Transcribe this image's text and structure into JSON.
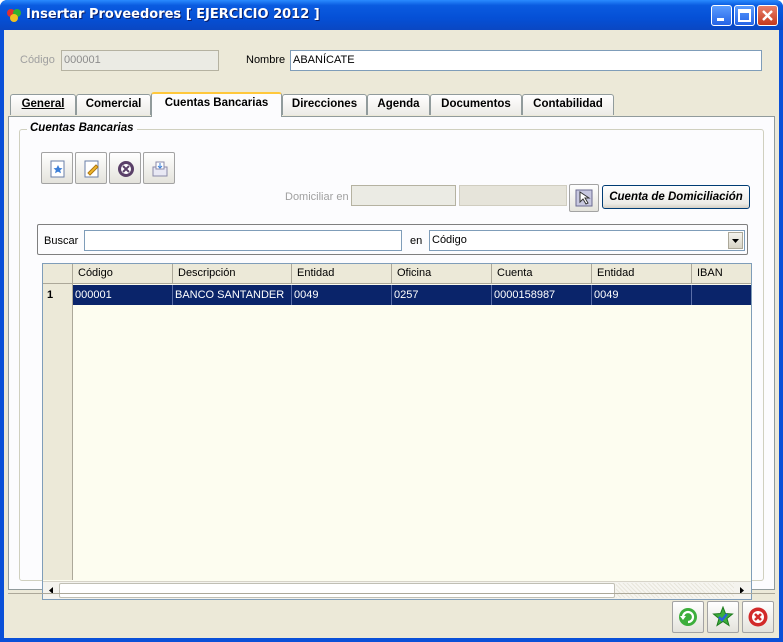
{
  "window": {
    "title": "Insertar Proveedores [ EJERCICIO 2012 ]"
  },
  "header": {
    "codigo_label": "Código",
    "codigo_value": "000001",
    "nombre_label": "Nombre",
    "nombre_value": "ABANÍCATE"
  },
  "tabs": [
    {
      "label": "General",
      "active": false
    },
    {
      "label": "Comercial",
      "active": false
    },
    {
      "label": "Cuentas Bancarias",
      "active": true
    },
    {
      "label": "Direcciones",
      "active": false
    },
    {
      "label": "Agenda",
      "active": false
    },
    {
      "label": "Documentos",
      "active": false
    },
    {
      "label": "Contabilidad",
      "active": false
    }
  ],
  "group": {
    "title": "Cuentas Bancarias"
  },
  "toolbar": {
    "domiciliar_label": "Domiciliar en",
    "domiciliar_value": "",
    "cuenta_button": "Cuenta de Domiciliación"
  },
  "search": {
    "label": "Buscar",
    "value": "",
    "en_label": "en",
    "field_selected": "Código"
  },
  "grid": {
    "columns": [
      "Código",
      "Descripción",
      "Entidad",
      "Oficina",
      "Cuenta",
      "Entidad",
      "IBAN"
    ],
    "rows": [
      {
        "num": "1",
        "cells": [
          "000001",
          "BANCO SANTANDER",
          "0049",
          "0257",
          "0000158987",
          "0049",
          ""
        ]
      }
    ]
  },
  "icons": [
    "new-record-icon",
    "edit-record-icon",
    "delete-record-icon",
    "print-icon",
    "pointer-icon",
    "refresh-icon",
    "accept-icon",
    "cancel-icon"
  ]
}
